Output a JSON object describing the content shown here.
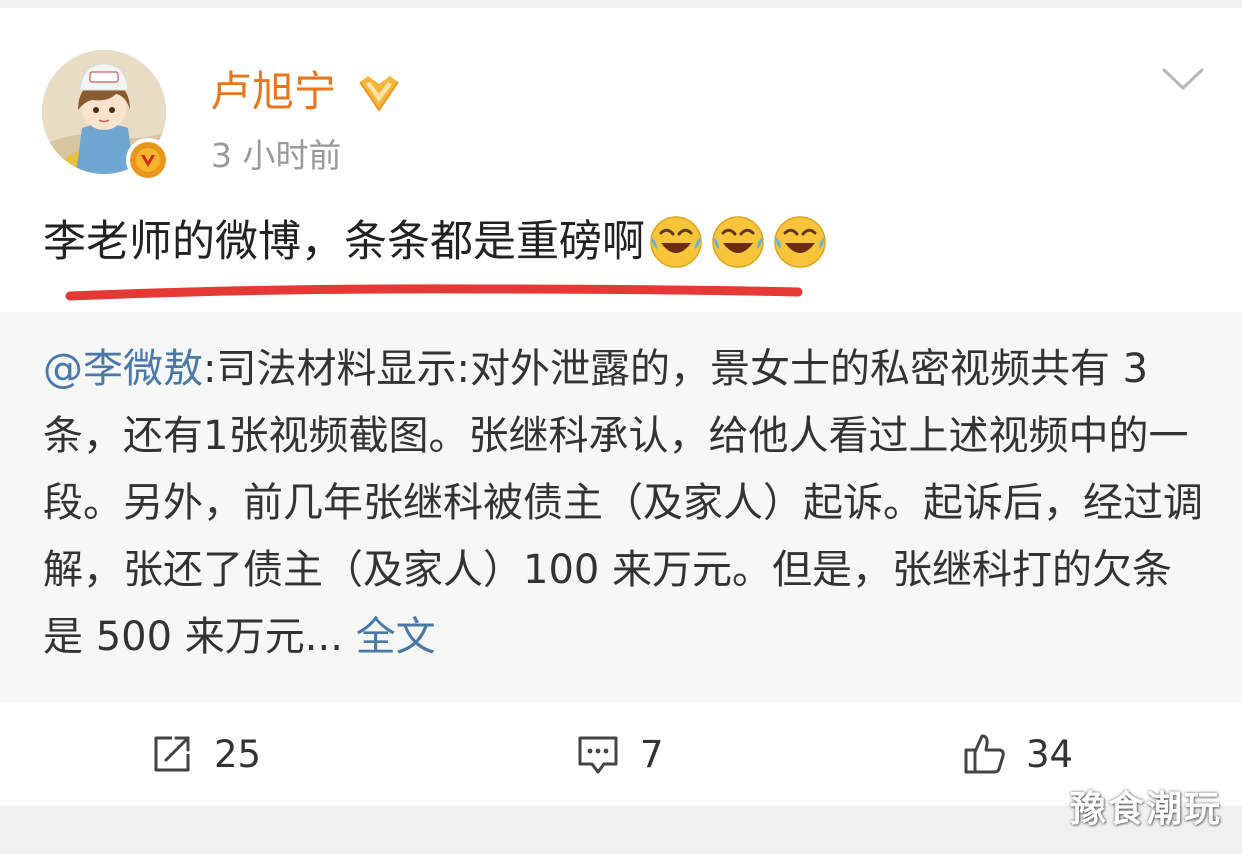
{
  "post": {
    "username": "卢旭宁",
    "timestamp": "3 小时前",
    "text": "李老师的微博，条条都是重磅啊",
    "emoji_icons": [
      "laughing-crying-emoji",
      "laughing-crying-emoji",
      "laughing-crying-emoji"
    ],
    "username_color": "#e8761f",
    "underline_color": "#e53935"
  },
  "repost": {
    "mention": "@李微敖",
    "body": ":司法材料显示:对外泄露的，景女士的私密视频共有 3 条，还有1张视频截图。张继科承认，给他人看过上述视频中的一段。另外，前几年张继科被债主（及家人）起诉。起诉后，经过调解，张还了债主（及家人）100 来万元。但是，张继科打的欠条是 500 来万元... ",
    "full_text_link": "全文",
    "link_color": "#4a79a8"
  },
  "actions": {
    "repost_count": "25",
    "comment_count": "7",
    "like_count": "34"
  },
  "watermark": "豫食潮玩"
}
